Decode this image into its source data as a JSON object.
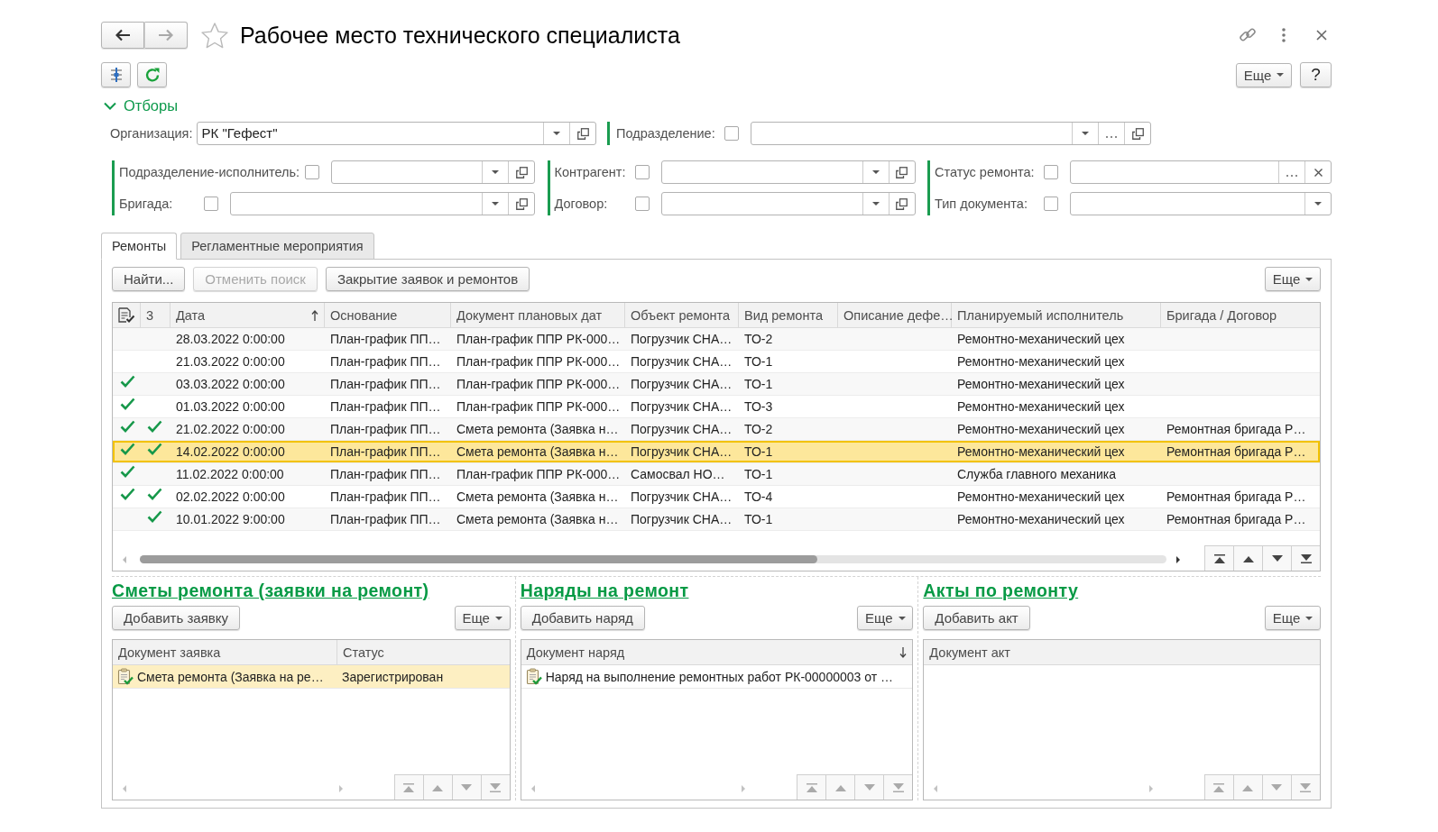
{
  "window": {
    "title": "Рабочее место технического специалиста",
    "favorite": false
  },
  "navigation": {
    "back": {
      "disabled": false
    },
    "forward": {
      "disabled": true
    }
  },
  "toolbar": {
    "more_button": "Еще",
    "help_button": "?"
  },
  "filters": {
    "title": "Отборы",
    "expanded": true,
    "top_row": [
      {
        "label": "Организация:",
        "value": "РК \"Гефест\"",
        "buttons": [
          {
            "kind": "dropdown"
          },
          {
            "kind": "open"
          }
        ]
      },
      {
        "label": "Подразделение:",
        "checked": false,
        "buttons": [
          {
            "kind": "dropdown"
          },
          {
            "kind": "select"
          },
          {
            "kind": "open"
          }
        ]
      }
    ],
    "groups": [
      {
        "fields": [
          {
            "label": "Подразделение-исполнитель:",
            "checked": false,
            "buttons": [
              {
                "kind": "dropdown"
              },
              {
                "kind": "open"
              }
            ]
          },
          {
            "label": "Бригада:",
            "checked": false,
            "buttons": [
              {
                "kind": "dropdown"
              },
              {
                "kind": "open"
              }
            ]
          }
        ]
      },
      {
        "fields": [
          {
            "label": "Контрагент:",
            "checked": false,
            "buttons": [
              {
                "kind": "dropdown"
              },
              {
                "kind": "open"
              }
            ]
          },
          {
            "label": "Договор:",
            "checked": false,
            "buttons": [
              {
                "kind": "dropdown"
              },
              {
                "kind": "open"
              }
            ]
          }
        ]
      },
      {
        "fields": [
          {
            "label": "Статус ремонта:",
            "checked": false,
            "buttons": [
              {
                "kind": "select"
              },
              {
                "kind": "clear"
              }
            ]
          },
          {
            "label": "Тип документа:",
            "checked": false,
            "buttons": [
              {
                "kind": "dropdown"
              }
            ]
          }
        ]
      }
    ]
  },
  "tabs": [
    {
      "label": "Ремонты",
      "selected": true
    },
    {
      "label": "Регламентные мероприятия",
      "selected": false
    }
  ],
  "commands": [
    {
      "label": "Найти...",
      "disabled": false
    },
    {
      "label": "Отменить поиск",
      "disabled": true
    },
    {
      "label": "Закрытие заявок и ремонтов",
      "disabled": false
    }
  ],
  "commands_more": "Еще",
  "table": {
    "columns": [
      {
        "kind": "check"
      },
      {
        "kind": "check",
        "label": "3"
      },
      {
        "kind": "text",
        "label": "Дата",
        "sorted": true,
        "descending": false
      },
      {
        "kind": "text",
        "label": "Основание"
      },
      {
        "kind": "text",
        "label": "Документ плановых дат"
      },
      {
        "kind": "text",
        "label": "Объект ремонта"
      },
      {
        "kind": "text",
        "label": "Вид ремонта"
      },
      {
        "kind": "text",
        "label": "Описание дефе…"
      },
      {
        "kind": "text",
        "label": "Планируемый исполнитель"
      },
      {
        "kind": "text",
        "label": "Бригада / Договор"
      }
    ],
    "rows": [
      {
        "checked_1": false,
        "checked_2": false,
        "selected": false,
        "date": "28.03.2022 0:00:00",
        "basis": "План-график ПП…",
        "plan_document": "План-график ППР РК-000…",
        "repair_object": "Погрузчик СНА…",
        "repair_type": "ТО-2",
        "planned_executor": "Ремонтно-механический цех"
      },
      {
        "checked_1": false,
        "checked_2": false,
        "selected": false,
        "date": "21.03.2022 0:00:00",
        "basis": "План-график ПП…",
        "plan_document": "План-график ППР РК-000…",
        "repair_object": "Погрузчик СНА…",
        "repair_type": "ТО-1",
        "planned_executor": "Ремонтно-механический цех"
      },
      {
        "checked_1": true,
        "checked_2": false,
        "selected": false,
        "date": "03.03.2022 0:00:00",
        "basis": "План-график ПП…",
        "plan_document": "План-график ППР РК-000…",
        "repair_object": "Погрузчик СНА…",
        "repair_type": "ТО-1",
        "planned_executor": "Ремонтно-механический цех"
      },
      {
        "checked_1": true,
        "checked_2": false,
        "selected": false,
        "date": "01.03.2022 0:00:00",
        "basis": "План-график ПП…",
        "plan_document": "План-график ППР РК-000…",
        "repair_object": "Погрузчик СНА…",
        "repair_type": "ТО-3",
        "planned_executor": "Ремонтно-механический цех"
      },
      {
        "checked_1": true,
        "checked_2": true,
        "selected": false,
        "date": "21.02.2022 0:00:00",
        "basis": "План-график ПП…",
        "plan_document": "Смета ремонта (Заявка н…",
        "repair_object": "Погрузчик СНА…",
        "repair_type": "ТО-2",
        "planned_executor": "Ремонтно-механический цех",
        "brigade_contract": "Ремонтная бригада Р…"
      },
      {
        "checked_1": true,
        "checked_2": true,
        "selected": true,
        "date": "14.02.2022 0:00:00",
        "basis": "План-график ПП…",
        "plan_document": "Смета ремонта (Заявка н…",
        "repair_object": "Погрузчик СНА…",
        "repair_type": "ТО-1",
        "planned_executor": "Ремонтно-механический цех",
        "brigade_contract": "Ремонтная бригада Р…"
      },
      {
        "checked_1": true,
        "checked_2": false,
        "selected": false,
        "date": "11.02.2022 0:00:00",
        "basis": "План-график ПП…",
        "plan_document": "План-график ППР РК-000…",
        "repair_object": "Самосвал НО…",
        "repair_type": "ТО-1",
        "planned_executor": "Служба главного механика"
      },
      {
        "checked_1": true,
        "checked_2": true,
        "selected": false,
        "date": "02.02.2022 0:00:00",
        "basis": "План-график ПП…",
        "plan_document": "Смета ремонта (Заявка н…",
        "repair_object": "Погрузчик СНА…",
        "repair_type": "ТО-4",
        "planned_executor": "Ремонтно-механический цех",
        "brigade_contract": "Ремонтная бригада Р…"
      },
      {
        "checked_1": false,
        "checked_2": true,
        "selected": false,
        "date": "10.01.2022 9:00:00",
        "basis": "План-график ПП…",
        "plan_document": "Смета ремонта (Заявка н…",
        "repair_object": "Погрузчик СНА…",
        "repair_type": "ТО-1",
        "planned_executor": "Ремонтно-механический цех",
        "brigade_contract": "Ремонтная бригада Р…"
      }
    ]
  },
  "sections": [
    {
      "title": "Сметы ремонта (заявки на ремонт)",
      "add_button": "Добавить заявку",
      "more_button": "Еще",
      "columns": [
        {
          "label": "Документ заявка"
        },
        {
          "label": "Статус"
        }
      ],
      "rows": [
        {
          "selected": true,
          "cells": [
            "Смета ремонта (Заявка на ре…",
            "Зарегистрирован"
          ]
        }
      ]
    },
    {
      "title": "Наряды на ремонт",
      "add_button": "Добавить наряд",
      "more_button": "Еще",
      "columns": [
        {
          "label": "Документ наряд",
          "sorted": true,
          "descending": true
        }
      ],
      "rows": [
        {
          "selected": false,
          "cells": [
            "Наряд на выполнение ремонтных работ РК-00000003 от …"
          ]
        }
      ]
    },
    {
      "title": "Акты по ремонту",
      "add_button": "Добавить акт",
      "more_button": "Еще",
      "columns": [
        {
          "label": "Документ акт"
        }
      ]
    }
  ]
}
